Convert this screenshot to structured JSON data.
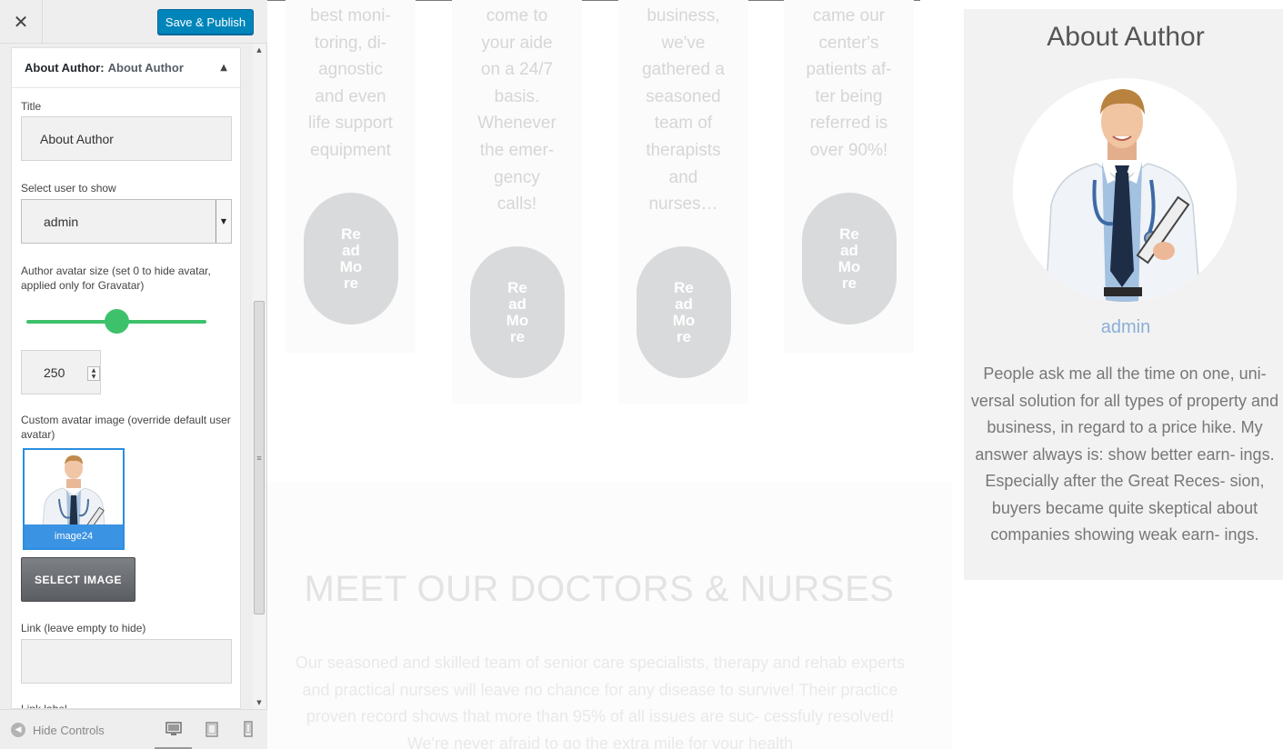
{
  "sidebar": {
    "close_icon": "close-icon",
    "publish_label": "Save & Publish",
    "publish_color": "#0085ba",
    "panel": {
      "title_prefix": "About Author:",
      "title_name": "About Author",
      "fields": {
        "title_label": "Title",
        "title_value": "About Author",
        "user_label": "Select user to show",
        "user_value": "admin",
        "avatar_size_label": "Author avatar size (set 0 to hide avatar, applied only for Gravatar)",
        "avatar_size_value": "250",
        "avatar_size_fraction": 0.5,
        "custom_avatar_label": "Custom avatar image (override default user avatar)",
        "custom_avatar_caption": "image24",
        "select_image_label": "SELECT IMAGE",
        "link_label": "Link (leave empty to hide)",
        "link_value": "",
        "link_label_label": "Link label"
      },
      "slider_color": "#3ec16b"
    },
    "footer": {
      "hide_controls_label": "Hide Controls",
      "devices": [
        "desktop-icon",
        "tablet-icon",
        "mobile-icon"
      ]
    }
  },
  "preview": {
    "columns": [
      {
        "text": [
          "best moni-",
          "toring, di-",
          "agnostic",
          "and even",
          "life support",
          "equipment"
        ],
        "button": "Read More"
      },
      {
        "text": [
          "come to",
          "your aide",
          "on a 24/7",
          "basis.",
          "Whenever",
          "the emer-",
          "gency",
          "calls!"
        ],
        "button": "Read More"
      },
      {
        "text": [
          "business,",
          "we've",
          "gathered a",
          "seasoned",
          "team of",
          "therapists",
          "and",
          "nurses…"
        ],
        "button": "Read More"
      },
      {
        "text": [
          "came our",
          "center's",
          "patients af-",
          "ter being",
          "referred is",
          "over 90%!"
        ],
        "button": "Read More"
      }
    ],
    "section_heading": "MEET OUR DOCTORS & NURSES",
    "section_text": "Our seasoned and skilled team of senior care specialists, therapy and rehab experts and practical nurses will leave no chance for any disease to survive! Their practice proven record shows that more than 95% of all issues are suc- cessfuly resolved! We're never afraid to go the extra mile for your health",
    "widget": {
      "title": "About Author",
      "name": "admin",
      "bio": "People ask me all the time on one, uni- versal solution for all types of property and business, in regard to a price hike. My answer always is: show better earn- ings. Especially after the Great Reces- sion, buyers became quite skeptical about companies showing weak earn- ings.",
      "name_color": "#8aafd7"
    }
  }
}
